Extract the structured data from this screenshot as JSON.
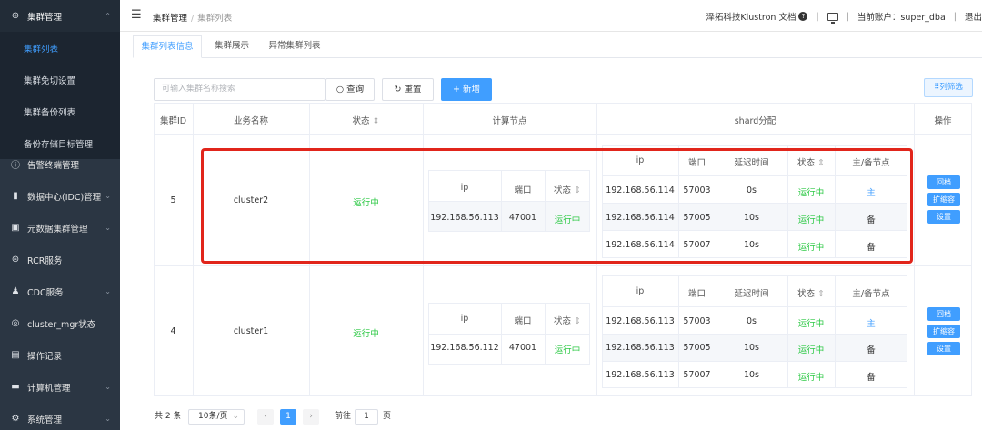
{
  "sidebar": {
    "items": [
      {
        "label": "集群管理",
        "icon": "plus-circle-icon"
      },
      {
        "label": "集群列表"
      },
      {
        "label": "集群免切设置"
      },
      {
        "label": "集群备份列表"
      },
      {
        "label": "备份存储目标管理"
      },
      {
        "label": "告警终端管理",
        "icon": "alert-circle-icon"
      },
      {
        "label": "数据中心(IDC)管理",
        "icon": "datacenter-icon"
      },
      {
        "label": "元数据集群管理",
        "icon": "metadata-icon"
      },
      {
        "label": "RCR服务",
        "icon": "rcr-icon"
      },
      {
        "label": "CDC服务",
        "icon": "user-icon"
      },
      {
        "label": "cluster_mgr状态",
        "icon": "status-icon"
      },
      {
        "label": "操作记录",
        "icon": "record-icon"
      },
      {
        "label": "计算机管理",
        "icon": "computer-icon"
      },
      {
        "label": "系统管理",
        "icon": "gear-icon"
      }
    ]
  },
  "topbar": {
    "breadcrumb": [
      "集群管理",
      "集群列表"
    ],
    "docs_link": "泽拓科技Klustron 文档",
    "account": "当前账户：super_dba",
    "logout": "退出"
  },
  "tabs": [
    "集群列表信息",
    "集群展示",
    "异常集群列表"
  ],
  "toolbar": {
    "search_placeholder": "可输入集群名称搜索",
    "query_label": "查询",
    "reset_label": "重置",
    "add_label": "新增",
    "columns_label": "列筛选"
  },
  "table": {
    "headers": {
      "id": "集群ID",
      "name": "业务名称",
      "status": "状态",
      "compute": "计算节点",
      "shard": "shard分配",
      "ops": "操作"
    },
    "compute_headers": {
      "ip": "ip",
      "port": "端口",
      "status": "状态"
    },
    "shard_headers": {
      "ip": "ip",
      "port": "端口",
      "delay": "延迟时间",
      "status": "状态",
      "role": "主/备节点"
    },
    "rows": [
      {
        "id": "5",
        "name": "cluster2",
        "status": "运行中",
        "compute": {
          "ip": "192.168.56.113",
          "port": "47001",
          "status": "运行中"
        },
        "shards": [
          {
            "ip": "192.168.56.114",
            "port": "57003",
            "delay": "0s",
            "status": "运行中",
            "role": "主"
          },
          {
            "ip": "192.168.56.114",
            "port": "57005",
            "delay": "10s",
            "status": "运行中",
            "role": "备"
          },
          {
            "ip": "192.168.56.114",
            "port": "57007",
            "delay": "10s",
            "status": "运行中",
            "role": "备"
          }
        ]
      },
      {
        "id": "4",
        "name": "cluster1",
        "status": "运行中",
        "compute": {
          "ip": "192.168.56.112",
          "port": "47001",
          "status": "运行中"
        },
        "shards": [
          {
            "ip": "192.168.56.113",
            "port": "57003",
            "delay": "0s",
            "status": "运行中",
            "role": "主"
          },
          {
            "ip": "192.168.56.113",
            "port": "57005",
            "delay": "10s",
            "status": "运行中",
            "role": "备"
          },
          {
            "ip": "192.168.56.113",
            "port": "57007",
            "delay": "10s",
            "status": "运行中",
            "role": "备"
          }
        ]
      }
    ],
    "op_labels": [
      "回档",
      "扩缩容",
      "设置"
    ]
  },
  "pagination": {
    "total": "共 2 条",
    "page_size": "10条/页",
    "current_page": "1",
    "goto_prefix": "前往",
    "goto_value": "1",
    "goto_suffix": "页"
  },
  "colors": {
    "sidebar_bg": "#2b3643",
    "accent": "#409eff",
    "running_green": "#2ec946",
    "highlight_red": "#e1251b"
  }
}
